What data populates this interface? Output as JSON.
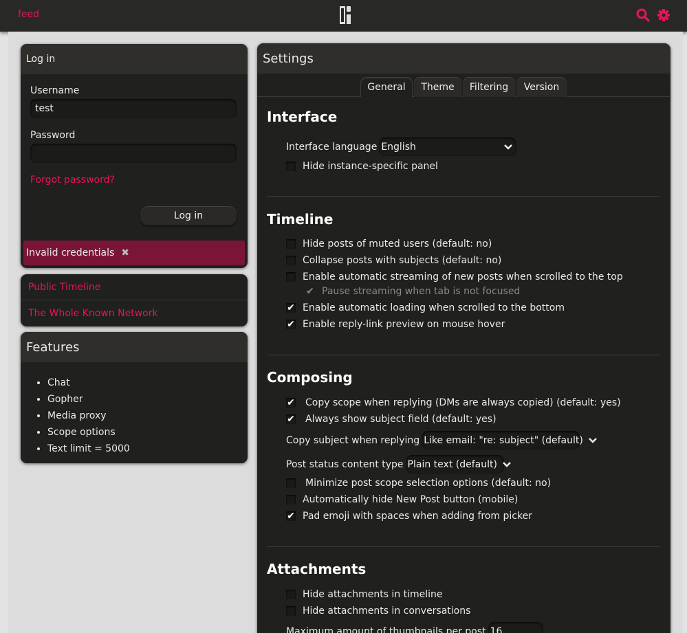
{
  "topbar": {
    "feed_label": "feed",
    "logo_icon": "pleroma-logo-icon",
    "search_icon": "search-icon",
    "settings_icon": "gear-icon",
    "accent": "#e8145a"
  },
  "login": {
    "title": "Log in",
    "username_label": "Username",
    "username_value": "test",
    "password_label": "Password",
    "password_value": "",
    "forgot_label": "Forgot password?",
    "submit_label": "Log in",
    "error_text": "Invalid credentials",
    "error_dismiss_icon": "close-icon"
  },
  "nav": {
    "items": [
      {
        "label": "Public Timeline"
      },
      {
        "label": "The Whole Known Network"
      }
    ]
  },
  "features": {
    "title": "Features",
    "items": [
      "Chat",
      "Gopher",
      "Media proxy",
      "Scope options",
      "Text limit = 5000"
    ]
  },
  "settings": {
    "title": "Settings",
    "tabs": [
      {
        "label": "General",
        "active": true
      },
      {
        "label": "Theme"
      },
      {
        "label": "Filtering"
      },
      {
        "label": "Version"
      }
    ],
    "interface": {
      "heading": "Interface",
      "language_label": "Interface language",
      "language_value": "English",
      "hide_panel_label": "Hide instance-specific panel",
      "hide_panel_checked": false
    },
    "timeline": {
      "heading": "Timeline",
      "options": [
        {
          "label": "Hide posts of muted users (default: no)",
          "checked": false
        },
        {
          "label": "Collapse posts with subjects (default: no)",
          "checked": false
        },
        {
          "label": "Enable automatic streaming of new posts when scrolled to the top",
          "checked": false
        },
        {
          "label": "Pause streaming when tab is not focused",
          "checked": true,
          "disabled": true
        },
        {
          "label": "Enable automatic loading when scrolled to the bottom",
          "checked": true
        },
        {
          "label": "Enable reply-link preview on mouse hover",
          "checked": true
        }
      ]
    },
    "composing": {
      "heading": "Composing",
      "copy_scope_label": "Copy scope when replying (DMs are always copied) (default: yes)",
      "always_subject_label": "Always show subject field (default: yes)",
      "copy_subject_label": "Copy subject when replying",
      "copy_subject_value": "Like email: \"re: subject\" (default)",
      "content_type_label": "Post status content type",
      "content_type_value": "Plain text (default)",
      "minimize_scope_label": "Minimize post scope selection options (default: no)",
      "hide_new_post_label": "Automatically hide New Post button (mobile)",
      "pad_emoji_label": "Pad emoji with spaces when adding from picker"
    },
    "attachments": {
      "heading": "Attachments",
      "hide_timeline_label": "Hide attachments in timeline",
      "hide_conversations_label": "Hide attachments in conversations",
      "max_thumbs_label": "Maximum amount of thumbnails per post",
      "max_thumbs_value": "16"
    },
    "check_glyph": "✔",
    "chevron_glyph": "⌄"
  }
}
